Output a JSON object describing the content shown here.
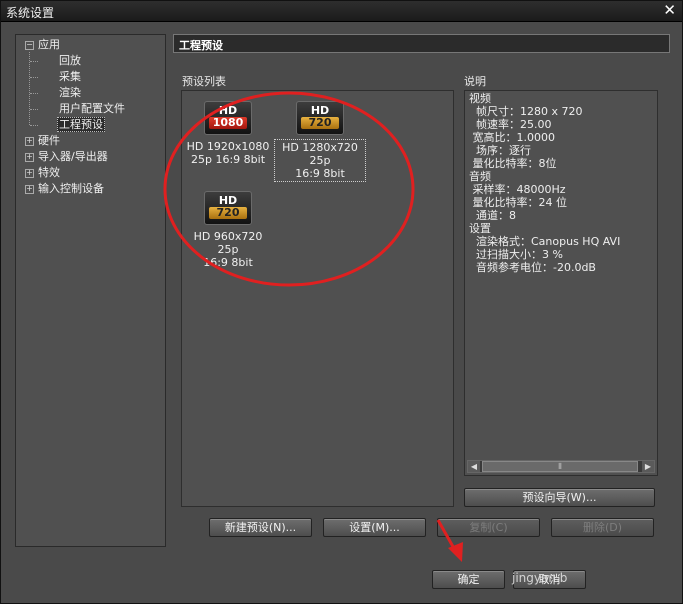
{
  "window": {
    "title": "系统设置",
    "close": "✕"
  },
  "tree": {
    "items": [
      {
        "label": "应用",
        "expander": "−"
      },
      {
        "label": "回放"
      },
      {
        "label": "采集"
      },
      {
        "label": "渲染"
      },
      {
        "label": "用户配置文件"
      },
      {
        "label": "工程预设"
      },
      {
        "label": "硬件",
        "expander": "+"
      },
      {
        "label": "导入器/导出器",
        "expander": "+"
      },
      {
        "label": "特效",
        "expander": "+"
      },
      {
        "label": "输入控制设备",
        "expander": "+"
      }
    ]
  },
  "panel": {
    "header": "工程预设",
    "list_label": "预设列表",
    "info_label": "说明"
  },
  "presets": [
    {
      "badge_top": "HD",
      "badge_bottom": "1080",
      "line1": "HD 1920x1080",
      "line2": "25p 16:9 8bit",
      "color": "#c42a1c"
    },
    {
      "badge_top": "HD",
      "badge_bottom": "720",
      "line1": "HD 1280x720 25p",
      "line2": "16:9 8bit",
      "color": "#c9922a",
      "selected": true
    },
    {
      "badge_top": "HD",
      "badge_bottom": "720",
      "line1": "HD 960x720 25p",
      "line2": "16:9 8bit",
      "color": "#c9922a"
    }
  ],
  "info_lines": [
    "视频",
    "  帧尺寸：1280 x 720",
    "  帧速率：25.00",
    " 宽高比：1.0000",
    "  场序：逐行",
    " 量化比特率：8位",
    "音频",
    " 采样率：48000Hz",
    " 量化比特率：24 位",
    "  通道：8",
    "设置",
    "  渲染格式：Canopus HQ AVI",
    "  过扫描大小：3 %",
    "  音频参考电位：-20.0dB"
  ],
  "buttons": {
    "wizard": "预设向导(W)...",
    "new": "新建预设(N)...",
    "settings": "设置(M)...",
    "copy": "复制(C)",
    "delete": "删除(D)",
    "ok": "确定",
    "cancel": "取消"
  },
  "watermark": "jingyan.b",
  "annotation_color": "#e02020"
}
